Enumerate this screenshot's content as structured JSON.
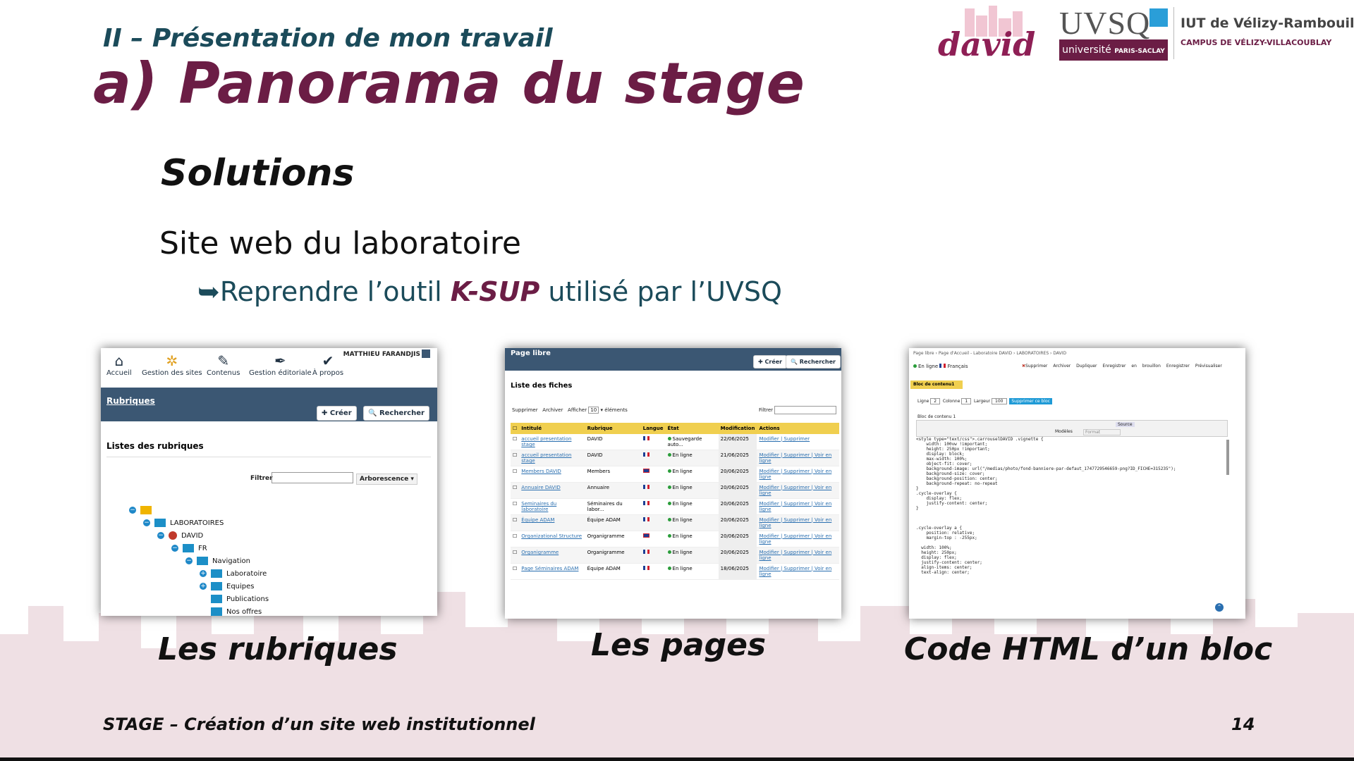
{
  "header": {
    "section_title": "II – Présentation de mon travail",
    "main_title": "a) Panorama du stage"
  },
  "logos": {
    "david": "david",
    "uvsq": "UVSQ",
    "uvsq_sub_a": "université",
    "uvsq_sub_b": "PARIS-SACLAY",
    "iut_name": "IUT de Vélizy-Rambouillet",
    "iut_campus": "CAMPUS DE VÉLIZY-VILLACOUBLAY"
  },
  "content": {
    "solutions": "Solutions",
    "subtitle": "Site web du laboratoire",
    "bullet_arrow": "➥",
    "bullet_pre": "Reprendre l’outil ",
    "bullet_kw": "K-SUP",
    "bullet_post": " utilisé par l’UVSQ"
  },
  "captions": {
    "rubriques": "Les rubriques",
    "pages": "Les pages",
    "code": "Code HTML d’un bloc"
  },
  "footer": {
    "left": "STAGE – Création d’un site web institutionnel",
    "page": "14"
  },
  "shot1": {
    "user": "MATTHIEU FARANDJIS",
    "nav": [
      "Accueil",
      "Gestion des sites",
      "Contenus",
      "Gestion éditoriale",
      "À propos"
    ],
    "band_title": "Rubriques",
    "create": "Créer",
    "search": "Rechercher",
    "list_title": "Listes des rubriques",
    "filter_label": "Filtrer",
    "tree_mode": "Arborescence",
    "tree": [
      "LABORATOIRES",
      "DAVID",
      "FR",
      "Navigation",
      "Laboratoire",
      "Equipes",
      "Publications",
      "Nos offres"
    ]
  },
  "shot2": {
    "header": "Page libre",
    "create": "Créer",
    "search": "Rechercher",
    "list_title": "Liste des fiches",
    "delete": "Supprimer",
    "archive": "Archiver",
    "show": "Afficher",
    "show_count": "10",
    "elements": "éléments",
    "filter": "Filtrer",
    "columns": [
      "Intitulé",
      "Rubrique",
      "Langue",
      "État",
      "Modification",
      "Actions"
    ],
    "rows": [
      {
        "title": "accueil presentation stage",
        "rubrique": "DAVID",
        "lang": "fr",
        "etat": "Sauvegarde auto...",
        "date": "22/06/2025",
        "actions": "Modifier | Supprimer"
      },
      {
        "title": "accueil presentation stage",
        "rubrique": "DAVID",
        "lang": "fr",
        "etat": "En ligne",
        "date": "21/06/2025",
        "actions": "Modifier | Supprimer | Voir en ligne"
      },
      {
        "title": "Members DAVID",
        "rubrique": "Members",
        "lang": "en",
        "etat": "En ligne",
        "date": "20/06/2025",
        "actions": "Modifier | Supprimer | Voir en ligne"
      },
      {
        "title": "Annuaire DAVID",
        "rubrique": "Annuaire",
        "lang": "fr",
        "etat": "En ligne",
        "date": "20/06/2025",
        "actions": "Modifier | Supprimer | Voir en ligne"
      },
      {
        "title": "Seminaires du laboratoire",
        "rubrique": "Séminaires du labor...",
        "lang": "fr",
        "etat": "En ligne",
        "date": "20/06/2025",
        "actions": "Modifier | Supprimer | Voir en ligne"
      },
      {
        "title": "Équipe ADAM",
        "rubrique": "Équipe ADAM",
        "lang": "fr",
        "etat": "En ligne",
        "date": "20/06/2025",
        "actions": "Modifier | Supprimer | Voir en ligne"
      },
      {
        "title": "Organizational Structure",
        "rubrique": "Organigramme",
        "lang": "en",
        "etat": "En ligne",
        "date": "20/06/2025",
        "actions": "Modifier | Supprimer | Voir en ligne"
      },
      {
        "title": "Organigramme",
        "rubrique": "Organigramme",
        "lang": "fr",
        "etat": "En ligne",
        "date": "20/06/2025",
        "actions": "Modifier | Supprimer | Voir en ligne"
      },
      {
        "title": "Page Séminaires ADAM",
        "rubrique": "Équipe ADAM",
        "lang": "fr",
        "etat": "En ligne",
        "date": "18/06/2025",
        "actions": "Modifier | Supprimer | Voir en ligne"
      }
    ]
  },
  "shot3": {
    "breadcrumb": "Page libre › Page d'Accueil - Laboratoire DAVID › LABORATOIRES › DAVID",
    "status": "En ligne",
    "lang": "Français",
    "toolbar": [
      "Supprimer",
      "Archiver",
      "Dupliquer",
      "Enregistrer en brouillon",
      "Enregistrer",
      "Prévisualiser"
    ],
    "block_tab": "Bloc de contenu1",
    "ligne_label": "Ligne",
    "ligne": "2",
    "colonne_label": "Colonne",
    "colonne": "1",
    "largeur_label": "Largeur",
    "largeur": "100",
    "delete_block": "Supprimer ce bloc",
    "block_label": "Bloc de contenu 1",
    "source_btn": "Source",
    "models": "Modèles",
    "format": "Format",
    "code": "<style type=\"text/css\">.carrouselDAVID .vignette {\n    width: 100vw !important;\n    height: 250px !important;\n    display: block;\n    max-width: 100%;\n    object-fit: cover;\n    background-image: url(\"/medias/photo/fond-banniere-par-defaut_1747729546659-png?ID_FICHE=315235\");\n    background-size: cover;\n    background-position: center;\n    background-repeat: no-repeat\n}\n.cycle-overlay {\n    display: flex;\n    justify-content: center;\n}\n\n\n\n.cycle-overlay a {\n    position: relative;\n    margin-top : -255px;\n\n  width: 100%;\n  height: 250px;\n  display: flex;\n  justify-content: center;\n  align-items: center;\n  text-align: center;"
  }
}
